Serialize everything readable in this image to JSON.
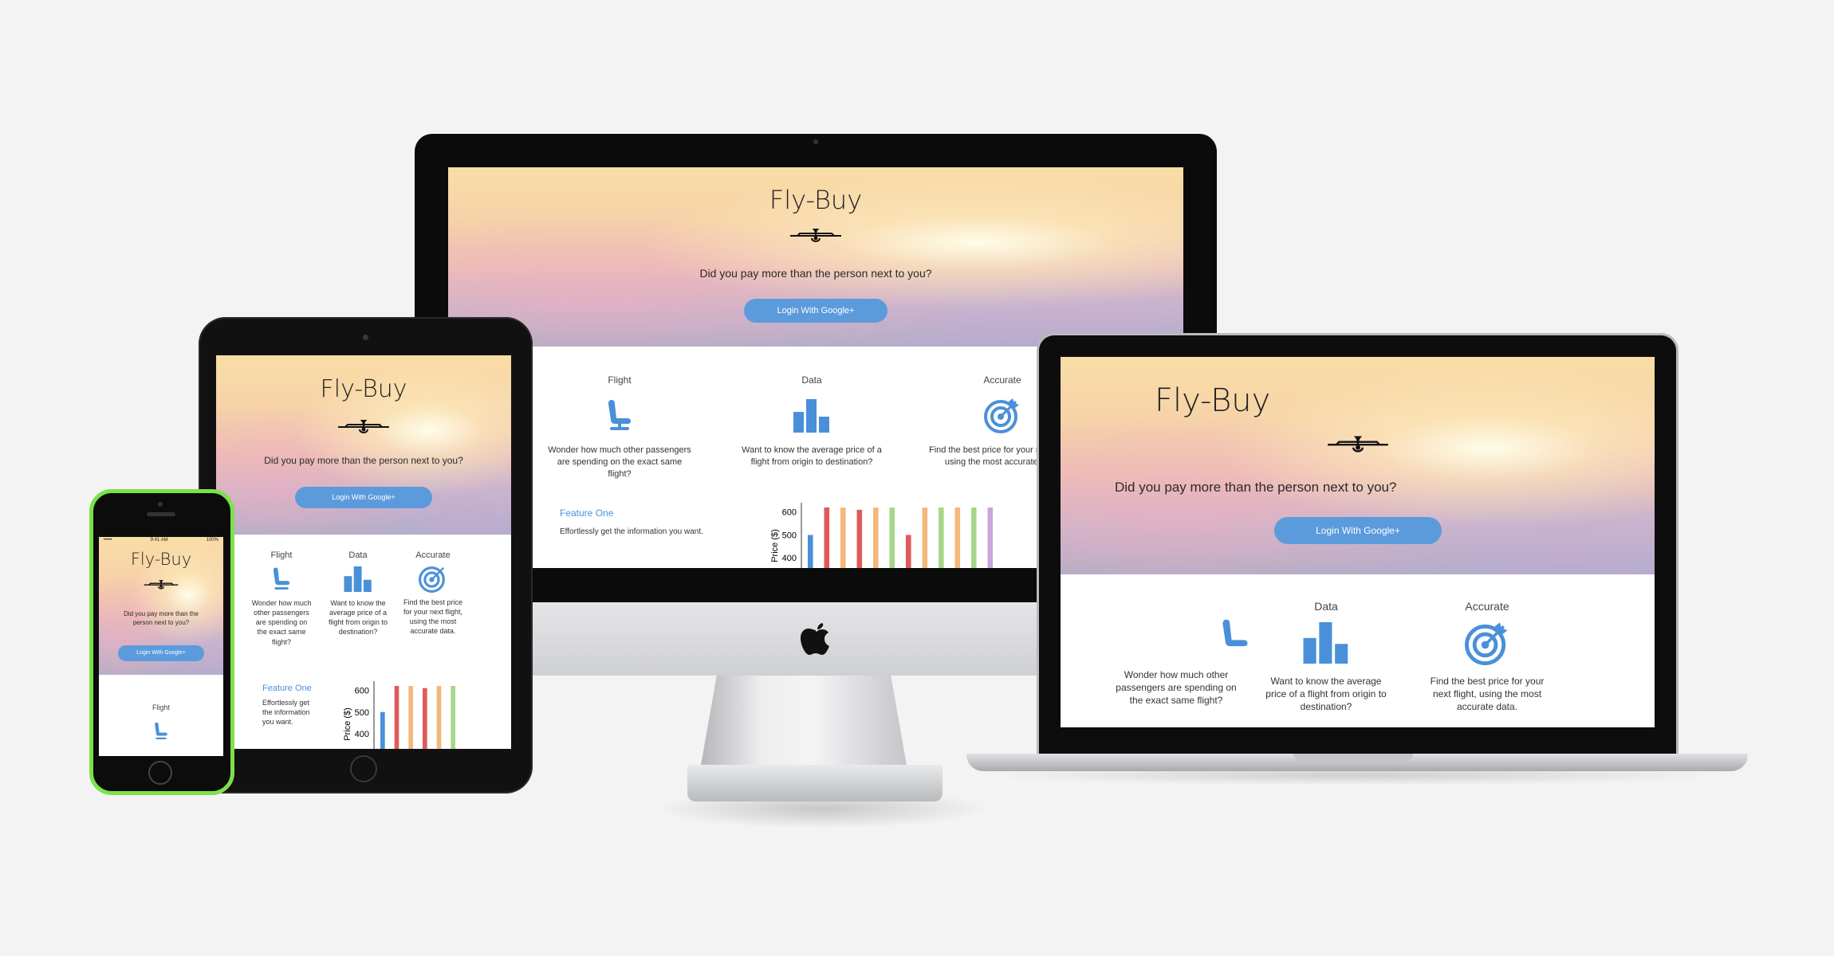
{
  "brand": {
    "title": "Fly-Buy",
    "tagline": "Did you pay more than the person next to you?",
    "login_button": "Login With Google+"
  },
  "features": [
    {
      "heading": "Flight",
      "icon": "seat-icon",
      "description": "Wonder how much other passengers are spending on the exact same flight?"
    },
    {
      "heading": "Data",
      "icon": "bar-chart-icon",
      "description": "Want to know the average price of a flight from origin to destination?"
    },
    {
      "heading": "Accurate",
      "icon": "target-icon",
      "description": "Find the best price for your next flight, using the most accurate data."
    }
  ],
  "feature_one": {
    "heading": "Feature One",
    "text": "Effortlessly get the information you want."
  },
  "phone_status": {
    "carrier": "•••••",
    "time": "9:41 AM",
    "battery": "100%"
  },
  "colors": {
    "accent": "#5b9bdc",
    "icon_blue": "#4a90d9",
    "phone_case": "#7be24a"
  },
  "chart_data": {
    "type": "bar",
    "ylabel": "Price ($)",
    "yticks": [
      600,
      500,
      400
    ],
    "ylim": [
      400,
      620
    ],
    "series_colors": [
      "#4a90d9",
      "#e05a5a",
      "#f5b77a",
      "#a6d68a",
      "#c9a6dc"
    ],
    "bars": [
      {
        "value": 500,
        "color": "#4a90d9"
      },
      {
        "value": 620,
        "color": "#e05a5a"
      },
      {
        "value": 620,
        "color": "#f5b77a"
      },
      {
        "value": 610,
        "color": "#e05a5a"
      },
      {
        "value": 620,
        "color": "#f5b77a"
      },
      {
        "value": 620,
        "color": "#a6d68a"
      },
      {
        "value": 500,
        "color": "#e05a5a"
      },
      {
        "value": 620,
        "color": "#f5b77a"
      },
      {
        "value": 620,
        "color": "#a6d68a"
      },
      {
        "value": 620,
        "color": "#f5b77a"
      },
      {
        "value": 620,
        "color": "#a6d68a"
      },
      {
        "value": 620,
        "color": "#c9a6dc"
      }
    ]
  }
}
